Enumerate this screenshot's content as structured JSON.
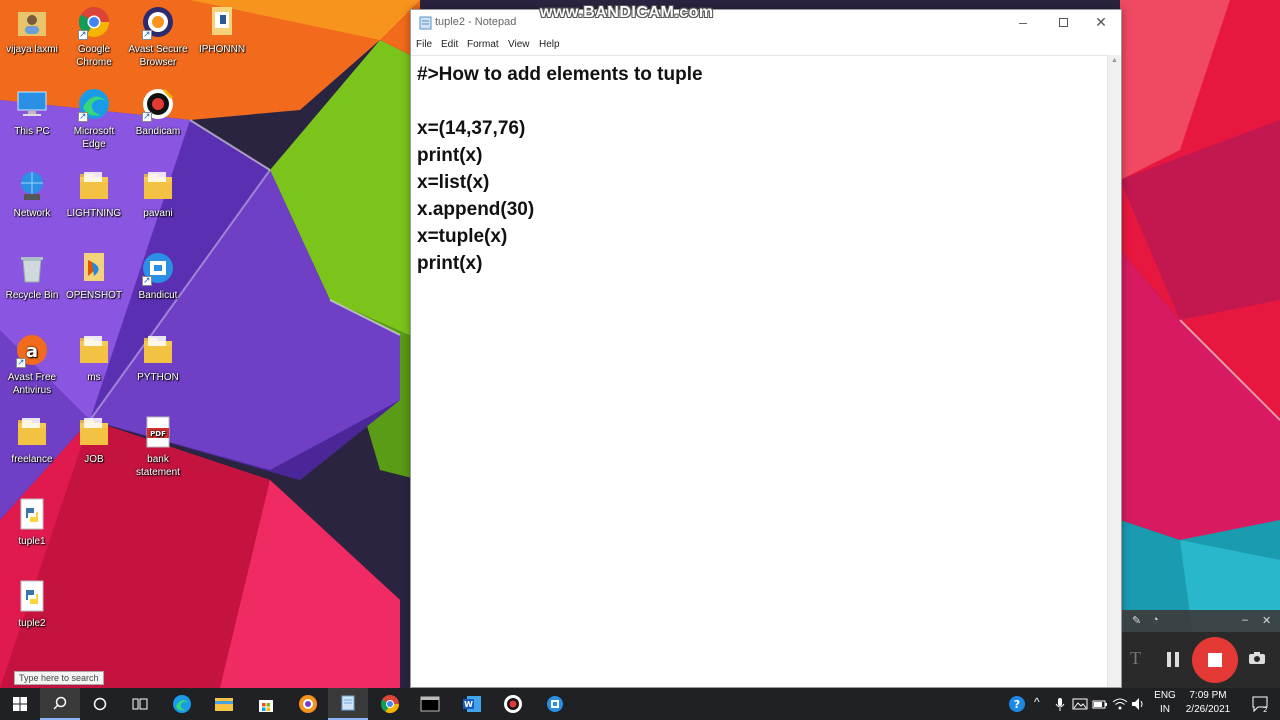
{
  "desktop": {
    "icons": [
      {
        "label": "vijaya laxmi",
        "icon": "user-folder-icon"
      },
      {
        "label": "Google Chrome",
        "icon": "chrome-icon"
      },
      {
        "label": "Avast Secure Browser",
        "icon": "avast-browser-icon"
      },
      {
        "label": "IPHONNN",
        "icon": "document-icon"
      },
      {
        "label": "This PC",
        "icon": "computer-icon"
      },
      {
        "label": "Microsoft Edge",
        "icon": "edge-icon"
      },
      {
        "label": "Bandicam",
        "icon": "bandicam-icon"
      },
      {
        "label": "Network",
        "icon": "network-icon"
      },
      {
        "label": "LIGHTNING",
        "icon": "folder-icon"
      },
      {
        "label": "pavani",
        "icon": "folder-icon"
      },
      {
        "label": "Recycle Bin",
        "icon": "recycle-bin-icon"
      },
      {
        "label": "OPENSHOT",
        "icon": "openshot-icon"
      },
      {
        "label": "Bandicut",
        "icon": "bandicut-icon"
      },
      {
        "label": "Avast Free Antivirus",
        "icon": "avast-antivirus-icon"
      },
      {
        "label": "ms",
        "icon": "folder-icon"
      },
      {
        "label": "PYTHON",
        "icon": "folder-icon"
      },
      {
        "label": "freelance",
        "icon": "folder-icon"
      },
      {
        "label": "JOB",
        "icon": "folder-icon"
      },
      {
        "label": "bank statement",
        "icon": "pdf-icon"
      },
      {
        "label": "tuple1",
        "icon": "python-file-icon"
      },
      {
        "label": "tuple2",
        "icon": "python-file-icon"
      }
    ]
  },
  "notepad": {
    "title": "tuple2 - Notepad",
    "menu": [
      "File",
      "Edit",
      "Format",
      "View",
      "Help"
    ],
    "lines": [
      "#>How to add elements to tuple",
      "",
      "x=(14,37,76)",
      "print(x)",
      "x=list(x)",
      "x.append(30)",
      "x=tuple(x)",
      "print(x)"
    ]
  },
  "watermark": "www.BANDICAM.com",
  "recorder": {
    "text_tool": "T"
  },
  "taskbar": {
    "search_tooltip": "Type here to search",
    "apps": [
      "start",
      "search",
      "cortana",
      "task-view",
      "edge",
      "file-explorer",
      "store",
      "avast-browser",
      "notepad",
      "chrome",
      "terminal",
      "word",
      "bandicam",
      "bandicut"
    ],
    "language": {
      "line1": "ENG",
      "line2": "IN"
    },
    "clock": {
      "time": "7:09 PM",
      "date": "2/26/2021"
    },
    "notification_count": "2"
  },
  "colors": {
    "taskbar": "#202124",
    "record_button": "#e53935",
    "notepad_text": "#111111"
  }
}
